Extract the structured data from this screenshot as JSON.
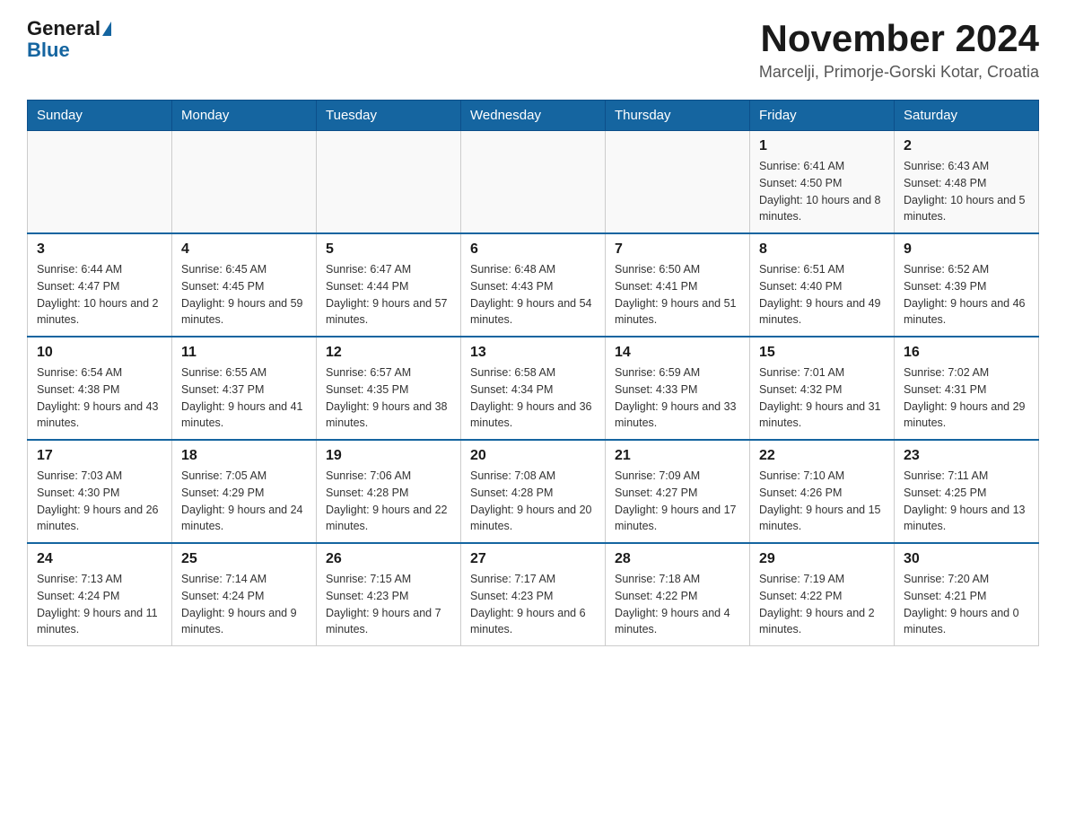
{
  "header": {
    "logo_general": "General",
    "logo_blue": "Blue",
    "title": "November 2024",
    "subtitle": "Marcelji, Primorje-Gorski Kotar, Croatia"
  },
  "days_of_week": [
    "Sunday",
    "Monday",
    "Tuesday",
    "Wednesday",
    "Thursday",
    "Friday",
    "Saturday"
  ],
  "weeks": [
    [
      {
        "day": "",
        "info": ""
      },
      {
        "day": "",
        "info": ""
      },
      {
        "day": "",
        "info": ""
      },
      {
        "day": "",
        "info": ""
      },
      {
        "day": "",
        "info": ""
      },
      {
        "day": "1",
        "info": "Sunrise: 6:41 AM\nSunset: 4:50 PM\nDaylight: 10 hours and 8 minutes."
      },
      {
        "day": "2",
        "info": "Sunrise: 6:43 AM\nSunset: 4:48 PM\nDaylight: 10 hours and 5 minutes."
      }
    ],
    [
      {
        "day": "3",
        "info": "Sunrise: 6:44 AM\nSunset: 4:47 PM\nDaylight: 10 hours and 2 minutes."
      },
      {
        "day": "4",
        "info": "Sunrise: 6:45 AM\nSunset: 4:45 PM\nDaylight: 9 hours and 59 minutes."
      },
      {
        "day": "5",
        "info": "Sunrise: 6:47 AM\nSunset: 4:44 PM\nDaylight: 9 hours and 57 minutes."
      },
      {
        "day": "6",
        "info": "Sunrise: 6:48 AM\nSunset: 4:43 PM\nDaylight: 9 hours and 54 minutes."
      },
      {
        "day": "7",
        "info": "Sunrise: 6:50 AM\nSunset: 4:41 PM\nDaylight: 9 hours and 51 minutes."
      },
      {
        "day": "8",
        "info": "Sunrise: 6:51 AM\nSunset: 4:40 PM\nDaylight: 9 hours and 49 minutes."
      },
      {
        "day": "9",
        "info": "Sunrise: 6:52 AM\nSunset: 4:39 PM\nDaylight: 9 hours and 46 minutes."
      }
    ],
    [
      {
        "day": "10",
        "info": "Sunrise: 6:54 AM\nSunset: 4:38 PM\nDaylight: 9 hours and 43 minutes."
      },
      {
        "day": "11",
        "info": "Sunrise: 6:55 AM\nSunset: 4:37 PM\nDaylight: 9 hours and 41 minutes."
      },
      {
        "day": "12",
        "info": "Sunrise: 6:57 AM\nSunset: 4:35 PM\nDaylight: 9 hours and 38 minutes."
      },
      {
        "day": "13",
        "info": "Sunrise: 6:58 AM\nSunset: 4:34 PM\nDaylight: 9 hours and 36 minutes."
      },
      {
        "day": "14",
        "info": "Sunrise: 6:59 AM\nSunset: 4:33 PM\nDaylight: 9 hours and 33 minutes."
      },
      {
        "day": "15",
        "info": "Sunrise: 7:01 AM\nSunset: 4:32 PM\nDaylight: 9 hours and 31 minutes."
      },
      {
        "day": "16",
        "info": "Sunrise: 7:02 AM\nSunset: 4:31 PM\nDaylight: 9 hours and 29 minutes."
      }
    ],
    [
      {
        "day": "17",
        "info": "Sunrise: 7:03 AM\nSunset: 4:30 PM\nDaylight: 9 hours and 26 minutes."
      },
      {
        "day": "18",
        "info": "Sunrise: 7:05 AM\nSunset: 4:29 PM\nDaylight: 9 hours and 24 minutes."
      },
      {
        "day": "19",
        "info": "Sunrise: 7:06 AM\nSunset: 4:28 PM\nDaylight: 9 hours and 22 minutes."
      },
      {
        "day": "20",
        "info": "Sunrise: 7:08 AM\nSunset: 4:28 PM\nDaylight: 9 hours and 20 minutes."
      },
      {
        "day": "21",
        "info": "Sunrise: 7:09 AM\nSunset: 4:27 PM\nDaylight: 9 hours and 17 minutes."
      },
      {
        "day": "22",
        "info": "Sunrise: 7:10 AM\nSunset: 4:26 PM\nDaylight: 9 hours and 15 minutes."
      },
      {
        "day": "23",
        "info": "Sunrise: 7:11 AM\nSunset: 4:25 PM\nDaylight: 9 hours and 13 minutes."
      }
    ],
    [
      {
        "day": "24",
        "info": "Sunrise: 7:13 AM\nSunset: 4:24 PM\nDaylight: 9 hours and 11 minutes."
      },
      {
        "day": "25",
        "info": "Sunrise: 7:14 AM\nSunset: 4:24 PM\nDaylight: 9 hours and 9 minutes."
      },
      {
        "day": "26",
        "info": "Sunrise: 7:15 AM\nSunset: 4:23 PM\nDaylight: 9 hours and 7 minutes."
      },
      {
        "day": "27",
        "info": "Sunrise: 7:17 AM\nSunset: 4:23 PM\nDaylight: 9 hours and 6 minutes."
      },
      {
        "day": "28",
        "info": "Sunrise: 7:18 AM\nSunset: 4:22 PM\nDaylight: 9 hours and 4 minutes."
      },
      {
        "day": "29",
        "info": "Sunrise: 7:19 AM\nSunset: 4:22 PM\nDaylight: 9 hours and 2 minutes."
      },
      {
        "day": "30",
        "info": "Sunrise: 7:20 AM\nSunset: 4:21 PM\nDaylight: 9 hours and 0 minutes."
      }
    ]
  ]
}
